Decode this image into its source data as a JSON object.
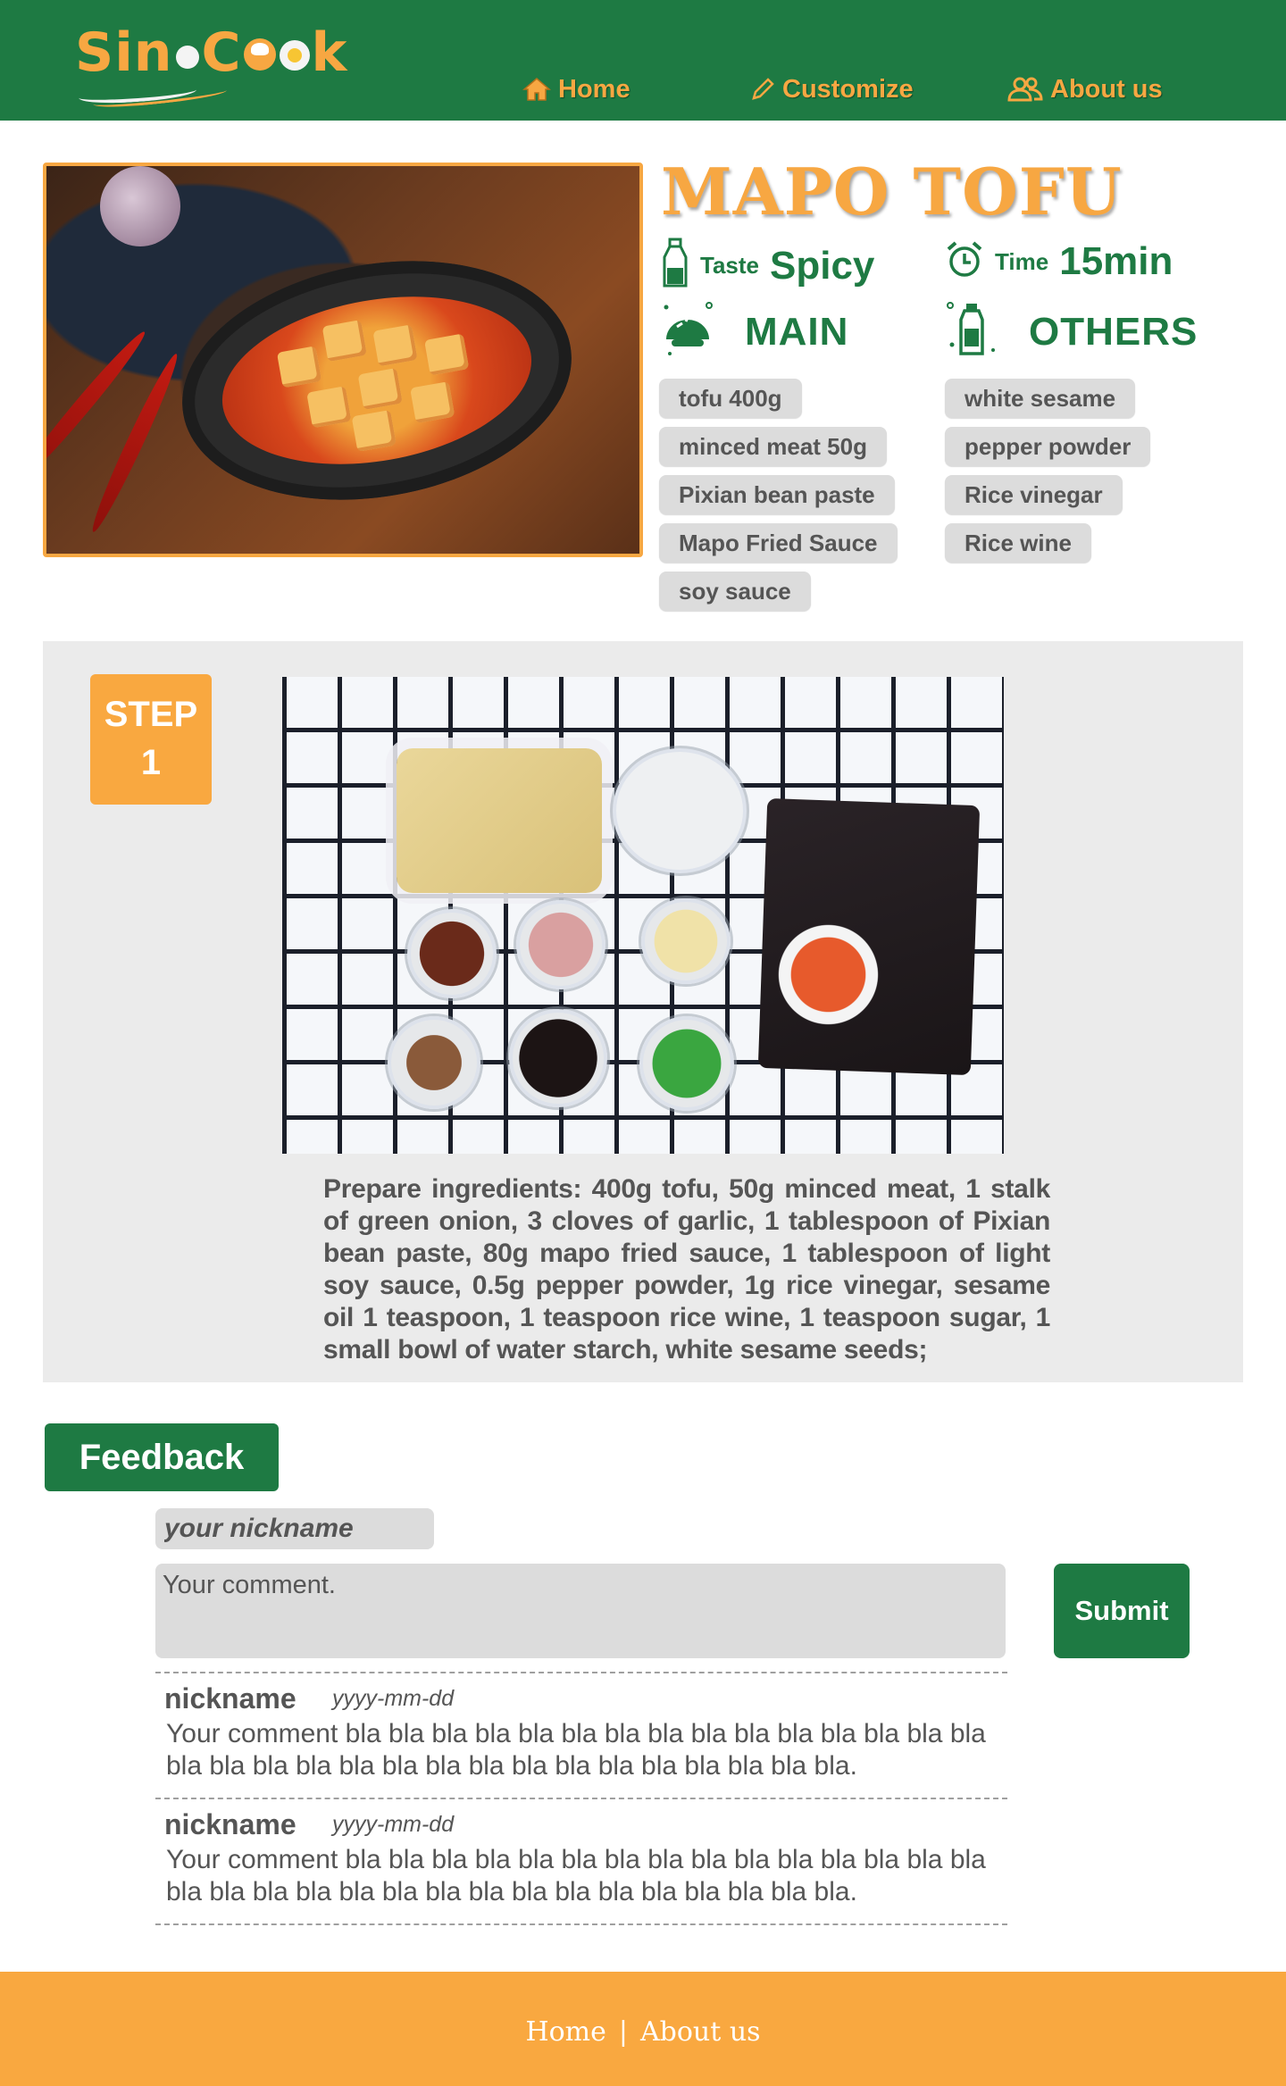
{
  "brand": {
    "name": "SinoCook",
    "primary_color": "#1e7a43",
    "accent_color": "#f7a742"
  },
  "nav": {
    "home": {
      "label": "Home",
      "icon": "home-icon"
    },
    "customize": {
      "label": "Customize",
      "icon": "pencil-icon"
    },
    "about": {
      "label": "About us",
      "icon": "users-icon"
    }
  },
  "recipe": {
    "title": "MAPO TOFU",
    "taste_label": "Taste",
    "taste_value": "Spicy",
    "time_label": "Time",
    "time_value": "15min",
    "main_title": "MAIN",
    "others_title": "OTHERS",
    "main_ingredients": [
      "tofu 400g",
      "minced meat 50g",
      "Pixian bean paste",
      "Mapo Fried Sauce",
      "soy sauce"
    ],
    "other_ingredients": [
      "white sesame",
      "pepper powder",
      "Rice vinegar",
      "Rice wine"
    ]
  },
  "step": {
    "label": "STEP",
    "number": "1",
    "text": "Prepare ingredients: 400g tofu, 50g minced meat, 1 stalk of green onion, 3 cloves of garlic, 1 tablespoon of Pixian bean paste, 80g mapo fried sauce, 1 tablespoon of light soy sauce, 0.5g pepper powder, 1g rice vinegar, sesame oil 1 teaspoon, 1 teaspoon rice wine, 1 teaspoon sugar, 1 small bowl of water starch, white sesame seeds;"
  },
  "feedback": {
    "title": "Feedback",
    "nickname_placeholder": "your nickname",
    "comment_placeholder": "Your comment.",
    "submit_label": "Submit",
    "comments": [
      {
        "nickname": "nickname",
        "date": "yyyy-mm-dd",
        "text": "Your comment bla bla bla bla bla bla bla bla bla bla bla bla bla bla bla bla bla bla bla bla bla bla bla bla bla bla bla bla bla bla bla."
      },
      {
        "nickname": "nickname",
        "date": "yyyy-mm-dd",
        "text": "Your comment bla bla bla bla bla bla bla bla bla bla bla bla bla bla bla bla bla bla bla bla bla bla bla bla bla bla bla bla bla bla bla."
      }
    ]
  },
  "footer": {
    "home": "Home",
    "separator": "|",
    "about": "About us"
  }
}
